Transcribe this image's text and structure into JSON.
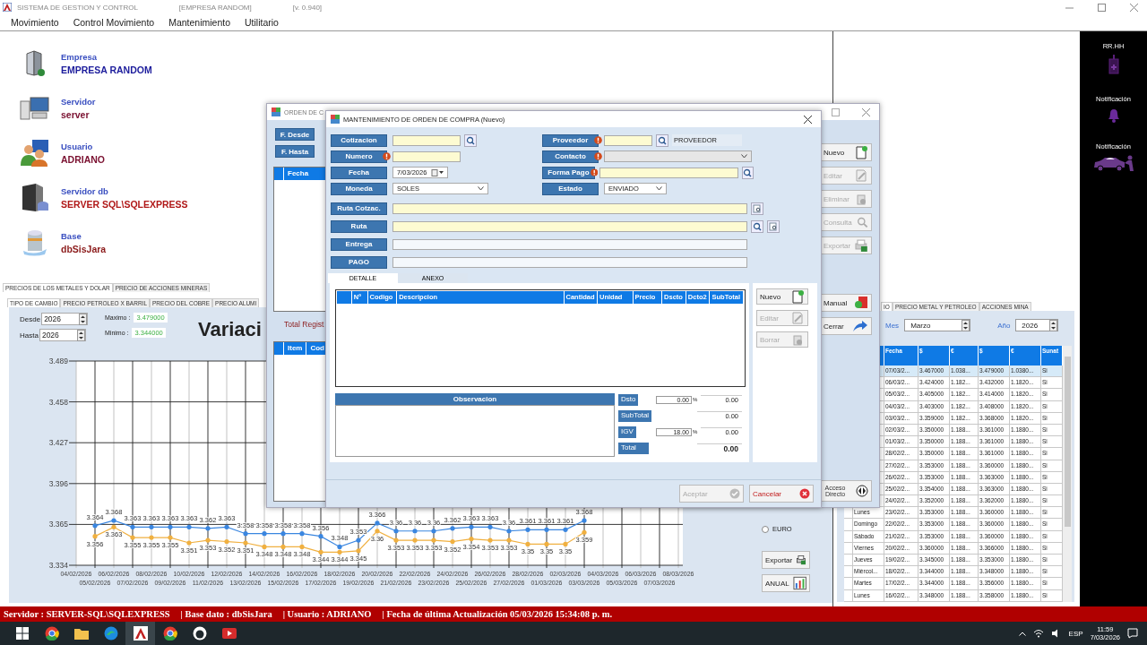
{
  "window": {
    "title": "SISTEMA DE GESTION Y CONTROL",
    "company": "[EMPRESA RANDOM]",
    "version": "[v. 0.940]"
  },
  "menu": [
    "Movimiento",
    "Control Movimiento",
    "Mantenimiento",
    "Utilitario"
  ],
  "info": [
    {
      "label": "Empresa",
      "value": "EMPRESA RANDOM",
      "color": "#1c1c9c",
      "kind": "building"
    },
    {
      "label": "Servidor",
      "value": "server",
      "color": "#7a1030",
      "kind": "computer"
    },
    {
      "label": "Usuario",
      "value": "ADRIANO",
      "color": "#7a1030",
      "kind": "users"
    },
    {
      "label": "Servidor db",
      "value": "SERVER SQL\\SQLEXPRESS",
      "color": "#b01818",
      "kind": "server"
    },
    {
      "label": "Base",
      "value": "dbSisJara",
      "color": "#8b1a1a",
      "kind": "database"
    }
  ],
  "main_tabs": [
    {
      "label": "PRECIOS DE LOS METALES Y DOLAR",
      "selected": true
    },
    {
      "label": "PRECIO DE ACCIONES MINERAS",
      "selected": false
    }
  ],
  "sub_tabs": [
    {
      "label": "TIPO DE CAMBIO",
      "selected": true
    },
    {
      "label": "PRECIO PETROLEO X BARRIL",
      "selected": false
    },
    {
      "label": "PRECIO DEL COBRE",
      "selected": false
    },
    {
      "label": "PRECIO ALUMI",
      "selected": false
    }
  ],
  "range": {
    "from_label": "Desde",
    "from": "2026",
    "to_label": "Hasta",
    "to": "2026",
    "max_label": "Maximo :",
    "max": "3.479000",
    "min_label": "Minimo :",
    "min": "3.344000"
  },
  "chart_data": {
    "type": "line",
    "title": "Variaci",
    "categories": [
      "04/02/2026",
      "05/02/2026",
      "06/02/2026",
      "07/02/2026",
      "08/02/2026",
      "09/02/2026",
      "10/02/2026",
      "11/02/2026",
      "12/02/2026",
      "13/02/2026",
      "14/02/2026",
      "15/02/2026",
      "16/02/2026",
      "17/02/2026",
      "18/02/2026",
      "19/02/2026",
      "20/02/2026",
      "21/02/2026",
      "22/02/2026",
      "23/02/2026",
      "24/02/2026",
      "25/02/2026",
      "26/02/2026",
      "27/02/2026",
      "28/02/2026",
      "01/03/2026",
      "02/03/2026",
      "03/03/2026",
      "04/03/2026",
      "05/03/2026",
      "06/03/2026",
      "07/03/2026",
      "08/03/2026"
    ],
    "series": [
      {
        "color": "#3a86e0",
        "values": [
          null,
          3.364,
          3.368,
          3.363,
          3.363,
          3.363,
          3.363,
          3.362,
          3.363,
          3.358,
          3.358,
          3.358,
          3.358,
          3.356,
          3.348,
          3.353,
          3.366,
          3.36,
          3.36,
          3.36,
          3.362,
          3.363,
          3.363,
          3.36,
          3.361,
          3.361,
          3.361,
          3.368,
          null,
          null,
          null,
          null,
          null
        ]
      },
      {
        "color": "#f0b040",
        "values": [
          null,
          3.356,
          3.363,
          3.355,
          3.355,
          3.355,
          3.351,
          3.353,
          3.352,
          3.351,
          3.348,
          3.348,
          3.348,
          3.344,
          3.344,
          3.345,
          3.36,
          3.353,
          3.353,
          3.353,
          3.352,
          3.354,
          3.353,
          3.353,
          3.35,
          3.35,
          3.35,
          3.359,
          null,
          null,
          null,
          null,
          null
        ]
      }
    ],
    "ylim": [
      3.334,
      3.489
    ],
    "yticks": [
      {
        "value": 3.334,
        "label": "3.334"
      },
      {
        "value": 3.365,
        "label": "3.365"
      },
      {
        "value": 3.396,
        "label": "3.396"
      },
      {
        "value": 3.427,
        "label": "3.427"
      },
      {
        "value": 3.458,
        "label": "3.458"
      },
      {
        "value": 3.489,
        "label": "3.489"
      }
    ],
    "data_labels": true,
    "grid": true
  },
  "currency": {
    "label": "EURO",
    "selected": false
  },
  "chart_buttons": [
    {
      "label": "Exportar",
      "kind": "export"
    },
    {
      "label": "ANUAL",
      "kind": "chart"
    }
  ],
  "rates": {
    "tabs": [
      {
        "label": "IO",
        "selected": true
      },
      {
        "label": "PRECIO METAL Y PETROLEO",
        "selected": false
      },
      {
        "label": "ACCIONES MINA",
        "selected": false
      }
    ],
    "month_label": "Mes",
    "month": "Marzo",
    "year_label": "Año",
    "year": "2026",
    "columns": [
      "Fecha",
      "$",
      "€",
      "$",
      "€",
      "Sunat"
    ],
    "rows": [
      {
        "selected": true,
        "cells": [
          "07/03/2...",
          "3.467000",
          "1.038...",
          "3.479000",
          "1.0380...",
          "Si"
        ]
      },
      {
        "selected": false,
        "cells": [
          "06/03/2...",
          "3.424000",
          "1.182...",
          "3.432000",
          "1.1820...",
          "Si"
        ]
      },
      {
        "selected": false,
        "cells": [
          "05/03/2...",
          "3.405000",
          "1.182...",
          "3.414000",
          "1.1820...",
          "Si"
        ]
      },
      {
        "selected": false,
        "cells": [
          "04/03/2...",
          "3.403000",
          "1.182...",
          "3.408000",
          "1.1820...",
          "Si"
        ]
      },
      {
        "selected": false,
        "cells": [
          "03/03/2...",
          "3.359000",
          "1.182...",
          "3.368000",
          "1.1820...",
          "Si"
        ]
      },
      {
        "selected": false,
        "cells": [
          "02/03/2...",
          "3.350000",
          "1.188...",
          "3.361000",
          "1.1880...",
          "Si"
        ]
      },
      {
        "selected": false,
        "cells": [
          "01/03/2...",
          "3.350000",
          "1.188...",
          "3.361000",
          "1.1880...",
          "Si"
        ]
      },
      {
        "selected": false,
        "cells": [
          "28/02/2...",
          "3.350000",
          "1.188...",
          "3.361000",
          "1.1880...",
          "Si"
        ]
      },
      {
        "selected": false,
        "cells": [
          "27/02/2...",
          "3.353000",
          "1.188...",
          "3.360000",
          "1.1880...",
          "Si"
        ]
      },
      {
        "selected": false,
        "cells": [
          "26/02/2...",
          "3.353000",
          "1.188...",
          "3.363000",
          "1.1880...",
          "Si"
        ]
      },
      {
        "selected": false,
        "cells": [
          "25/02/2...",
          "3.354000",
          "1.188...",
          "3.363000",
          "1.1880...",
          "Si"
        ]
      },
      {
        "selected": false,
        "cells": [
          "24/02/2...",
          "3.352000",
          "1.188...",
          "3.362000",
          "1.1880...",
          "Si"
        ]
      },
      {
        "selected": false,
        "day": "Lunes",
        "cells": [
          "23/02/2...",
          "3.353000",
          "1.188...",
          "3.360000",
          "1.1880...",
          "Si"
        ]
      },
      {
        "selected": false,
        "day": "Domingo",
        "cells": [
          "22/02/2...",
          "3.353000",
          "1.188...",
          "3.360000",
          "1.1880...",
          "Si"
        ]
      },
      {
        "selected": false,
        "day": "Sábado",
        "cells": [
          "21/02/2...",
          "3.353000",
          "1.188...",
          "3.360000",
          "1.1880...",
          "Si"
        ]
      },
      {
        "selected": false,
        "day": "Viernes",
        "cells": [
          "20/02/2...",
          "3.360000",
          "1.188...",
          "3.366000",
          "1.1880...",
          "Si"
        ]
      },
      {
        "selected": false,
        "day": "Jueves",
        "cells": [
          "19/02/2...",
          "3.345000",
          "1.188...",
          "3.353000",
          "1.1880...",
          "Si"
        ]
      },
      {
        "selected": false,
        "day": "Miércol...",
        "cells": [
          "18/02/2...",
          "3.344000",
          "1.188...",
          "3.348000",
          "1.1880...",
          "Si"
        ]
      },
      {
        "selected": false,
        "day": "Martes",
        "cells": [
          "17/02/2...",
          "3.344000",
          "1.188...",
          "3.356000",
          "1.1880...",
          "Si"
        ]
      },
      {
        "selected": false,
        "day": "Lunes",
        "cells": [
          "16/02/2...",
          "3.348000",
          "1.188...",
          "3.358000",
          "1.1880...",
          "Si"
        ]
      }
    ]
  },
  "sidebar": [
    {
      "label": "RR.HH",
      "kind": "badge"
    },
    {
      "label": "Notificación",
      "kind": "bell"
    },
    {
      "label": "Notificación",
      "kind": "car"
    }
  ],
  "status_bar": [
    "Servidor : SERVER-SQL\\SQLEXPRESS",
    "| Base dato : dbSisJara",
    "| Usuario :  ADRIANO",
    "| Fecha de última Actualización 05/03/2026 15:34:08 p. m."
  ],
  "taskbar": {
    "apps": [
      {
        "kind": "start",
        "selected": false
      },
      {
        "kind": "browser",
        "selected": false
      },
      {
        "kind": "folder",
        "selected": false
      },
      {
        "kind": "edge",
        "selected": false
      },
      {
        "kind": "app",
        "selected": true
      },
      {
        "kind": "browser",
        "selected": false
      },
      {
        "kind": "cat",
        "selected": false
      },
      {
        "kind": "video",
        "selected": false
      }
    ],
    "lang": "ESP",
    "time": "11:59",
    "date": "7/03/2026"
  },
  "orden": {
    "title": "ORDEN DE C",
    "filters": [
      "F. Desde",
      "F. Hasta"
    ],
    "grid_columns": [
      "Fecha"
    ],
    "total": "Total Regist",
    "grid2_columns": [
      "Item",
      "Cod"
    ],
    "buttons": [
      {
        "label": "Nuevo",
        "kind": "new",
        "disabled": false
      },
      {
        "label": "Editar",
        "kind": "edit",
        "disabled": true
      },
      {
        "label": "Eliminar",
        "kind": "delete",
        "disabled": true
      },
      {
        "label": "Consulta",
        "kind": "search",
        "disabled": true
      },
      {
        "label": "Exportar",
        "kind": "export",
        "disabled": true
      },
      {
        "label": "Manual",
        "kind": "pdf",
        "disabled": false
      },
      {
        "label": "Cerrar",
        "kind": "exit",
        "disabled": false
      }
    ],
    "shortcut": "Acceso Directo"
  },
  "modal": {
    "title": "MANTENIMIENTO DE ORDEN DE COMPRA (Nuevo)",
    "left_fields": [
      {
        "label": "Cotizacion",
        "kind": "text",
        "required": false,
        "highlighted": true,
        "tools": [
          {
            "kind": "search"
          }
        ]
      },
      {
        "label": "Numero",
        "kind": "text",
        "required": true,
        "highlighted": true
      },
      {
        "label": "Fecha",
        "kind": "date",
        "required": false,
        "value": "7/03/2026"
      },
      {
        "label": "Moneda",
        "kind": "select",
        "required": false,
        "value": "SOLES",
        "disabled": false
      }
    ],
    "right_fields": [
      {
        "label": "Proveedor",
        "kind": "text",
        "required": true,
        "highlighted": true,
        "tools": [
          {
            "kind": "search"
          }
        ],
        "display": "PROVEEDOR"
      },
      {
        "label": "Contacto",
        "kind": "select",
        "required": true,
        "disabled": true
      },
      {
        "label": "Forma Pago",
        "kind": "text",
        "required": true,
        "highlighted": true,
        "tools": [
          {
            "kind": "search"
          }
        ]
      },
      {
        "label": "Estado",
        "kind": "select",
        "required": false,
        "value": "ENVIADO",
        "disabled": false
      }
    ],
    "wide_fields": [
      {
        "label": "Ruta Cotzac.",
        "kind": "text",
        "highlighted": true,
        "tools": [
          {
            "kind": "browse"
          }
        ]
      },
      {
        "label": "Ruta",
        "kind": "text",
        "highlighted": true,
        "tools": [
          {
            "kind": "search"
          },
          {
            "kind": "browse"
          }
        ]
      },
      {
        "label": "Entrega",
        "kind": "text",
        "highlighted": false
      },
      {
        "label": "PAGO",
        "kind": "text",
        "highlighted": false
      }
    ],
    "tabs": [
      {
        "label": "DETALLE",
        "selected": true
      },
      {
        "label": "ANEXO",
        "selected": false
      }
    ],
    "columns": [
      "Nº",
      "Codigo",
      "Descripcion",
      "Cantidad",
      "Unidad",
      "Precio",
      "Dscto",
      "Dcto2",
      "SubTotal"
    ],
    "side_buttons": [
      {
        "label": "Nuevo",
        "kind": "new",
        "disabled": false
      },
      {
        "label": "Editar",
        "kind": "edit",
        "disabled": true
      },
      {
        "label": "Borrar",
        "kind": "delete",
        "disabled": true
      }
    ],
    "observation": "Observacion",
    "totals": [
      {
        "label": "Dsto",
        "rate": "0.00",
        "unit": "%",
        "amount": "0.00",
        "kind": "normal"
      },
      {
        "label": "SubTotal",
        "amount": "0.00",
        "kind": "normal"
      },
      {
        "label": "IGV",
        "rate": "18.00",
        "unit": "%",
        "amount": "0.00",
        "kind": "normal"
      },
      {
        "label": "Total",
        "amount": "0.00",
        "kind": "total"
      }
    ],
    "footer": [
      {
        "label": "Aceptar",
        "kind": "ok",
        "disabled": true
      },
      {
        "label": "Cancelar",
        "kind": "cancel",
        "disabled": false
      }
    ]
  }
}
